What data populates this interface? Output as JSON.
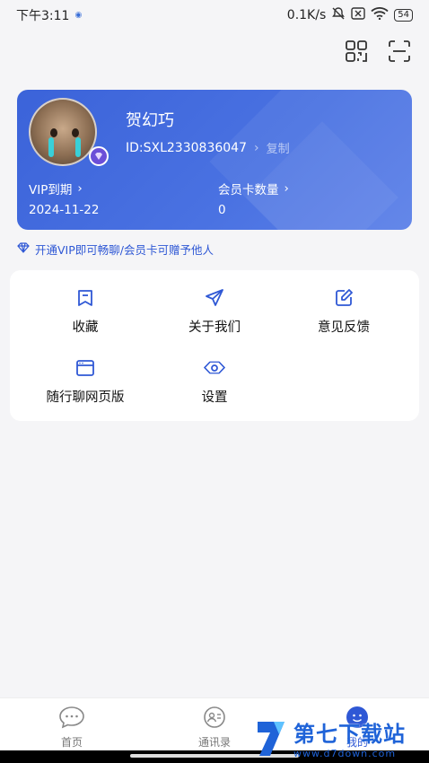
{
  "status_bar": {
    "time": "下午3:11",
    "speed": "0.1K/s",
    "battery": "54"
  },
  "member_card": {
    "username": "贺幻巧",
    "user_id": "ID:SXL2330836047",
    "copy_label": "复制",
    "vip_label": "VIP到期",
    "vip_expiry": "2024-11-22",
    "cards_label": "会员卡数量",
    "cards_count": "0"
  },
  "promo_text": "开通VIP即可畅聊/会员卡可赠予他人",
  "menu": {
    "items": [
      {
        "label": "收藏",
        "icon": "bookmark-icon"
      },
      {
        "label": "关于我们",
        "icon": "send-icon"
      },
      {
        "label": "意见反馈",
        "icon": "edit-icon"
      },
      {
        "label": "随行聊网页版",
        "icon": "browser-icon"
      },
      {
        "label": "设置",
        "icon": "settings-icon"
      }
    ]
  },
  "bottom_nav": {
    "items": [
      {
        "label": "首页",
        "icon": "chat-bubble-icon"
      },
      {
        "label": "通讯录",
        "icon": "contacts-icon"
      },
      {
        "label": "我的",
        "icon": "profile-icon",
        "active": true
      }
    ]
  },
  "watermark": {
    "title": "第七下载站",
    "url": "www.d7down.com"
  },
  "colors": {
    "accent": "#2f58d5",
    "card": "#3b63d9",
    "background": "#f5f5f7"
  }
}
